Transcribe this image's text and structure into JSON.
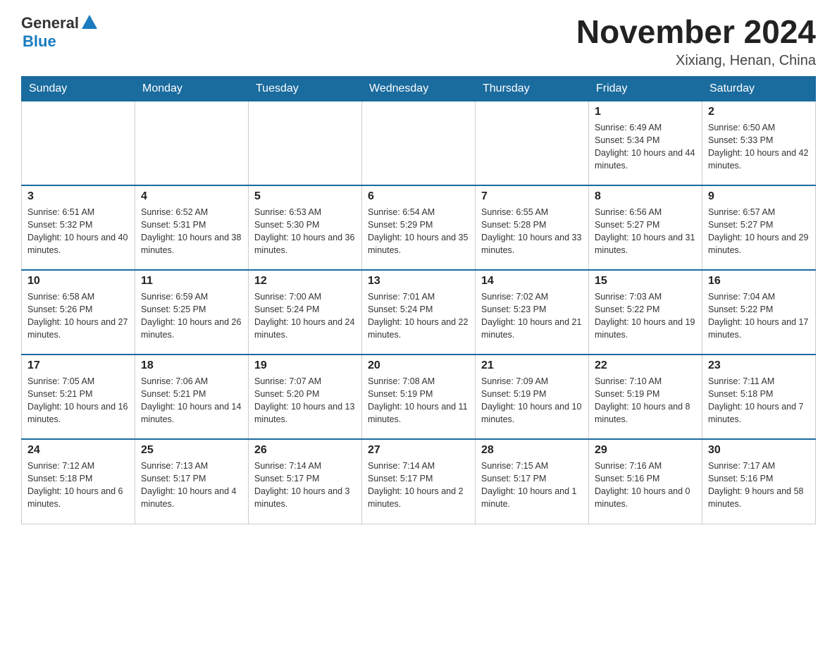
{
  "header": {
    "logo_general": "General",
    "logo_blue": "Blue",
    "month_title": "November 2024",
    "subtitle": "Xixiang, Henan, China"
  },
  "days_of_week": [
    "Sunday",
    "Monday",
    "Tuesday",
    "Wednesday",
    "Thursday",
    "Friday",
    "Saturday"
  ],
  "weeks": [
    [
      {
        "day": "",
        "info": ""
      },
      {
        "day": "",
        "info": ""
      },
      {
        "day": "",
        "info": ""
      },
      {
        "day": "",
        "info": ""
      },
      {
        "day": "",
        "info": ""
      },
      {
        "day": "1",
        "info": "Sunrise: 6:49 AM\nSunset: 5:34 PM\nDaylight: 10 hours and 44 minutes."
      },
      {
        "day": "2",
        "info": "Sunrise: 6:50 AM\nSunset: 5:33 PM\nDaylight: 10 hours and 42 minutes."
      }
    ],
    [
      {
        "day": "3",
        "info": "Sunrise: 6:51 AM\nSunset: 5:32 PM\nDaylight: 10 hours and 40 minutes."
      },
      {
        "day": "4",
        "info": "Sunrise: 6:52 AM\nSunset: 5:31 PM\nDaylight: 10 hours and 38 minutes."
      },
      {
        "day": "5",
        "info": "Sunrise: 6:53 AM\nSunset: 5:30 PM\nDaylight: 10 hours and 36 minutes."
      },
      {
        "day": "6",
        "info": "Sunrise: 6:54 AM\nSunset: 5:29 PM\nDaylight: 10 hours and 35 minutes."
      },
      {
        "day": "7",
        "info": "Sunrise: 6:55 AM\nSunset: 5:28 PM\nDaylight: 10 hours and 33 minutes."
      },
      {
        "day": "8",
        "info": "Sunrise: 6:56 AM\nSunset: 5:27 PM\nDaylight: 10 hours and 31 minutes."
      },
      {
        "day": "9",
        "info": "Sunrise: 6:57 AM\nSunset: 5:27 PM\nDaylight: 10 hours and 29 minutes."
      }
    ],
    [
      {
        "day": "10",
        "info": "Sunrise: 6:58 AM\nSunset: 5:26 PM\nDaylight: 10 hours and 27 minutes."
      },
      {
        "day": "11",
        "info": "Sunrise: 6:59 AM\nSunset: 5:25 PM\nDaylight: 10 hours and 26 minutes."
      },
      {
        "day": "12",
        "info": "Sunrise: 7:00 AM\nSunset: 5:24 PM\nDaylight: 10 hours and 24 minutes."
      },
      {
        "day": "13",
        "info": "Sunrise: 7:01 AM\nSunset: 5:24 PM\nDaylight: 10 hours and 22 minutes."
      },
      {
        "day": "14",
        "info": "Sunrise: 7:02 AM\nSunset: 5:23 PM\nDaylight: 10 hours and 21 minutes."
      },
      {
        "day": "15",
        "info": "Sunrise: 7:03 AM\nSunset: 5:22 PM\nDaylight: 10 hours and 19 minutes."
      },
      {
        "day": "16",
        "info": "Sunrise: 7:04 AM\nSunset: 5:22 PM\nDaylight: 10 hours and 17 minutes."
      }
    ],
    [
      {
        "day": "17",
        "info": "Sunrise: 7:05 AM\nSunset: 5:21 PM\nDaylight: 10 hours and 16 minutes."
      },
      {
        "day": "18",
        "info": "Sunrise: 7:06 AM\nSunset: 5:21 PM\nDaylight: 10 hours and 14 minutes."
      },
      {
        "day": "19",
        "info": "Sunrise: 7:07 AM\nSunset: 5:20 PM\nDaylight: 10 hours and 13 minutes."
      },
      {
        "day": "20",
        "info": "Sunrise: 7:08 AM\nSunset: 5:19 PM\nDaylight: 10 hours and 11 minutes."
      },
      {
        "day": "21",
        "info": "Sunrise: 7:09 AM\nSunset: 5:19 PM\nDaylight: 10 hours and 10 minutes."
      },
      {
        "day": "22",
        "info": "Sunrise: 7:10 AM\nSunset: 5:19 PM\nDaylight: 10 hours and 8 minutes."
      },
      {
        "day": "23",
        "info": "Sunrise: 7:11 AM\nSunset: 5:18 PM\nDaylight: 10 hours and 7 minutes."
      }
    ],
    [
      {
        "day": "24",
        "info": "Sunrise: 7:12 AM\nSunset: 5:18 PM\nDaylight: 10 hours and 6 minutes."
      },
      {
        "day": "25",
        "info": "Sunrise: 7:13 AM\nSunset: 5:17 PM\nDaylight: 10 hours and 4 minutes."
      },
      {
        "day": "26",
        "info": "Sunrise: 7:14 AM\nSunset: 5:17 PM\nDaylight: 10 hours and 3 minutes."
      },
      {
        "day": "27",
        "info": "Sunrise: 7:14 AM\nSunset: 5:17 PM\nDaylight: 10 hours and 2 minutes."
      },
      {
        "day": "28",
        "info": "Sunrise: 7:15 AM\nSunset: 5:17 PM\nDaylight: 10 hours and 1 minute."
      },
      {
        "day": "29",
        "info": "Sunrise: 7:16 AM\nSunset: 5:16 PM\nDaylight: 10 hours and 0 minutes."
      },
      {
        "day": "30",
        "info": "Sunrise: 7:17 AM\nSunset: 5:16 PM\nDaylight: 9 hours and 58 minutes."
      }
    ]
  ]
}
